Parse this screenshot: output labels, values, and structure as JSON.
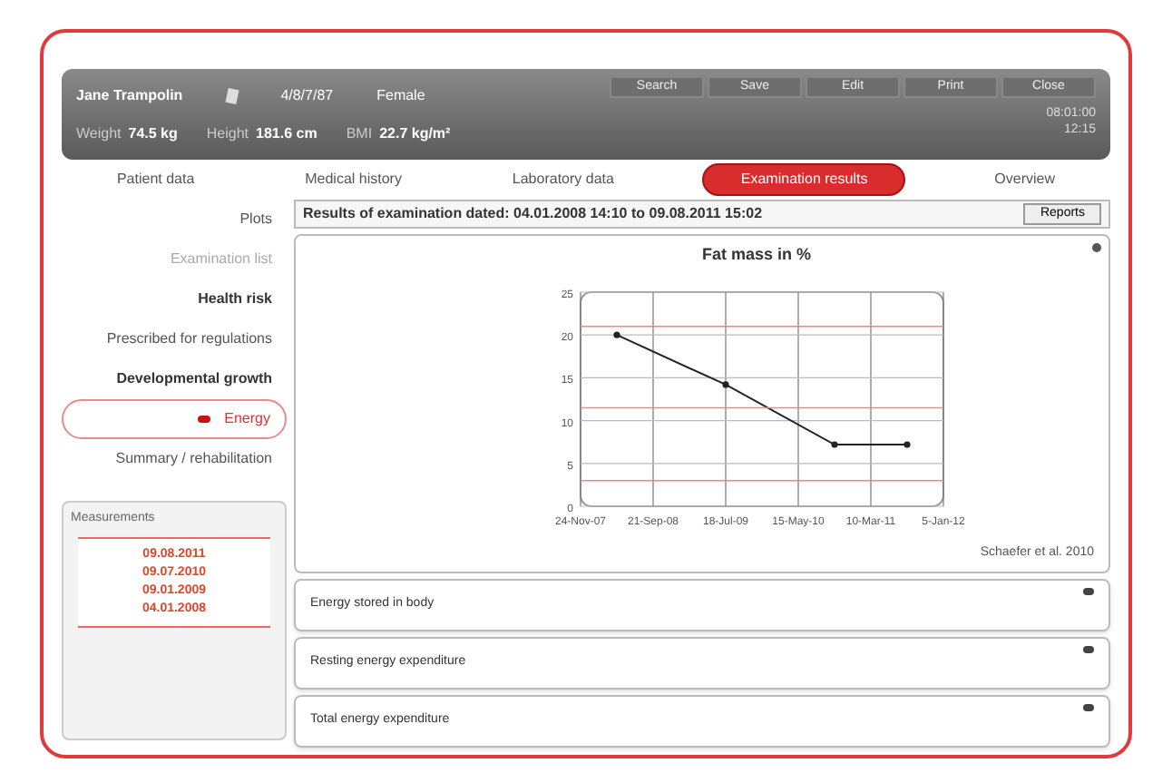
{
  "header": {
    "patient_name": "Jane Trampolin",
    "patient_id": "4/8/7/87",
    "gender": "Female",
    "measures": [
      {
        "label": "Weight",
        "value": "74.5 kg"
      },
      {
        "label": "Height",
        "value": "181.6 cm"
      },
      {
        "label": "BMI",
        "value": "22.7 kg/m²"
      }
    ],
    "toolbar": [
      "Search",
      "Save",
      "Edit",
      "Print",
      "Close"
    ],
    "clock": [
      "08:01:00",
      "12:15"
    ]
  },
  "tabs": [
    {
      "label": "Patient data",
      "selected": false
    },
    {
      "label": "Medical history",
      "selected": false
    },
    {
      "label": "Laboratory data",
      "selected": false
    },
    {
      "label": "Examination results",
      "selected": true
    },
    {
      "label": "Overview",
      "selected": false
    }
  ],
  "sidebar": {
    "items": [
      {
        "label": "Plots",
        "kind": "plain",
        "selected": false
      },
      {
        "label": "Examination list",
        "kind": "muted",
        "selected": false
      },
      {
        "label": "Health risk",
        "kind": "bold",
        "selected": false
      },
      {
        "label": "Prescribed for regulations",
        "kind": "plain",
        "selected": false
      },
      {
        "label": "Developmental growth",
        "kind": "bold",
        "selected": false
      },
      {
        "label": "Energy",
        "kind": "plain",
        "selected": true
      },
      {
        "label": "Summary / rehabilitation",
        "kind": "plain",
        "selected": false
      }
    ],
    "measurements": {
      "title": "Measurements",
      "dates": [
        "09.08.2011",
        "09.07.2010",
        "09.01.2009",
        "04.01.2008"
      ]
    }
  },
  "main": {
    "title": "Results of examination dated: 04.01.2008 14:10 to 09.08.2011 15:02",
    "button": "Reports",
    "chart": {
      "chart_data": {
        "type": "line",
        "title": "Fat mass in %",
        "categories": [
          "24-Nov-07",
          null,
          "21-Sep-08",
          null,
          "18-Jul-09",
          null,
          "15-May-10",
          null,
          "10-Mar-11",
          null,
          "5-Jan-12"
        ],
        "ylim": [
          0,
          25
        ],
        "yticks": [
          0,
          5,
          10,
          15,
          20,
          25
        ],
        "series": [
          {
            "color": "#222222",
            "marker": "o",
            "values": [
              null,
              20,
              null,
              null,
              14.2,
              null,
              null,
              7.2,
              null,
              7.2,
              null
            ]
          },
          {
            "color": "#ee8888",
            "values": [
              21,
              21,
              21,
              21,
              21,
              21,
              21,
              21,
              21,
              21,
              21
            ]
          },
          {
            "color": "#ee8888",
            "values": [
              11.5,
              11.5,
              11.5,
              11.5,
              11.5,
              11.5,
              11.5,
              11.5,
              11.5,
              11.5,
              11.5
            ]
          },
          {
            "color": "#ee8888",
            "values": [
              3,
              3,
              3,
              3,
              3,
              3,
              3,
              3,
              3,
              3,
              3
            ]
          }
        ],
        "grid": true
      },
      "source": "Schaefer et al. 2010"
    },
    "panels": [
      {
        "title": "Energy stored in body",
        "expanded": false
      },
      {
        "title": "Resting energy expenditure",
        "expanded": false
      },
      {
        "title": "Total energy expenditure",
        "expanded": false
      }
    ]
  }
}
